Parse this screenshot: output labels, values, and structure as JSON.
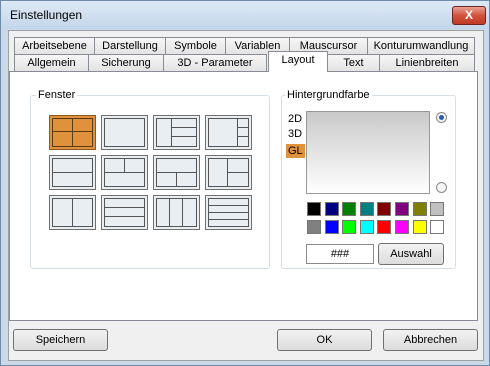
{
  "window": {
    "title": "Einstellungen",
    "close_label": "X"
  },
  "tabs_back": [
    "Arbeitsebene",
    "Darstellung",
    "Symbole",
    "Variablen",
    "Mauscursor",
    "Konturumwandlung"
  ],
  "tabs_front": [
    "Allgemein",
    "Sicherung",
    "3D - Parameter",
    "Layout",
    "Text",
    "Linienbreiten"
  ],
  "active_tab": "Layout",
  "fenster": {
    "label": "Fenster",
    "selected_index": 0
  },
  "hintergrund": {
    "label": "Hintergrundfarbe",
    "modes": [
      "2D",
      "3D",
      "GL"
    ],
    "selected_mode": "GL",
    "radio_top_selected": true,
    "hex_value": "###",
    "choose_label": "Auswahl",
    "colors_row1": [
      "#000000",
      "#000080",
      "#008000",
      "#008080",
      "#800000",
      "#800080",
      "#808000",
      "#c0c0c0"
    ],
    "colors_row2": [
      "#808080",
      "#0000ff",
      "#00ff00",
      "#00ffff",
      "#ff0000",
      "#ff00ff",
      "#ffff00",
      "#ffffff"
    ]
  },
  "buttons": {
    "save": "Speichern",
    "ok": "OK",
    "cancel": "Abbrechen"
  }
}
